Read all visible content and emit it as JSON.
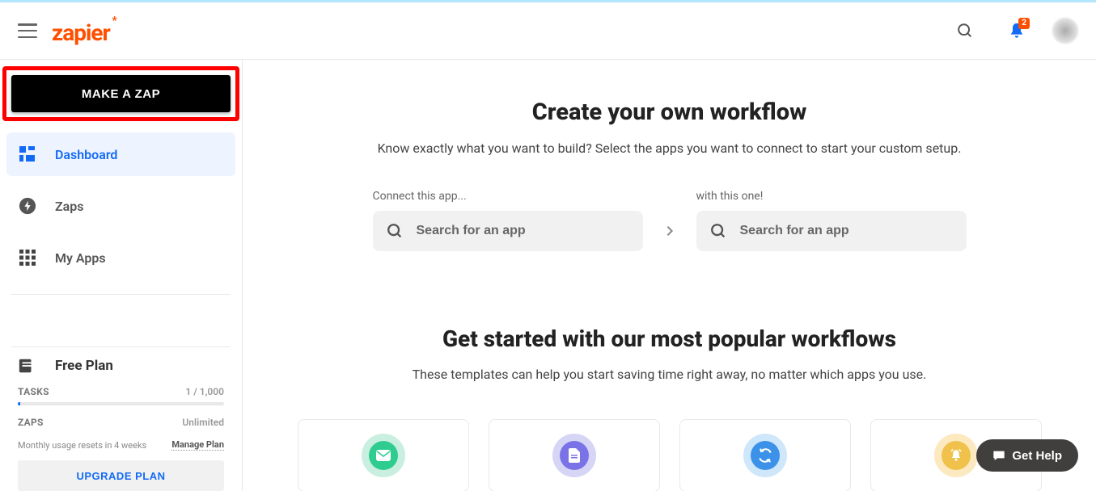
{
  "header": {
    "logo": "zapier",
    "notif_count": "2"
  },
  "sidebar": {
    "make_zap_label": "MAKE A ZAP",
    "items": [
      {
        "label": "Dashboard"
      },
      {
        "label": "Zaps"
      },
      {
        "label": "My Apps"
      }
    ],
    "plan": {
      "title": "Free Plan",
      "tasks_label": "TASKS",
      "tasks_value": "1 / 1,000",
      "zaps_label": "ZAPS",
      "zaps_value": "Unlimited",
      "reset_text": "Monthly usage resets in 4 weeks",
      "manage_label": "Manage Plan",
      "upgrade_label": "UPGRADE PLAN"
    }
  },
  "main": {
    "heading": "Create your own workflow",
    "subtitle": "Know exactly what you want to build? Select the apps you want to connect to start your custom setup.",
    "connect_left_label": "Connect this app...",
    "connect_right_label": "with this one!",
    "search_placeholder": "Search for an app",
    "popular_heading": "Get started with our most popular workflows",
    "popular_subtitle": "These templates can help you start saving time right away, no matter which apps you use."
  },
  "help": {
    "label": "Get Help"
  }
}
